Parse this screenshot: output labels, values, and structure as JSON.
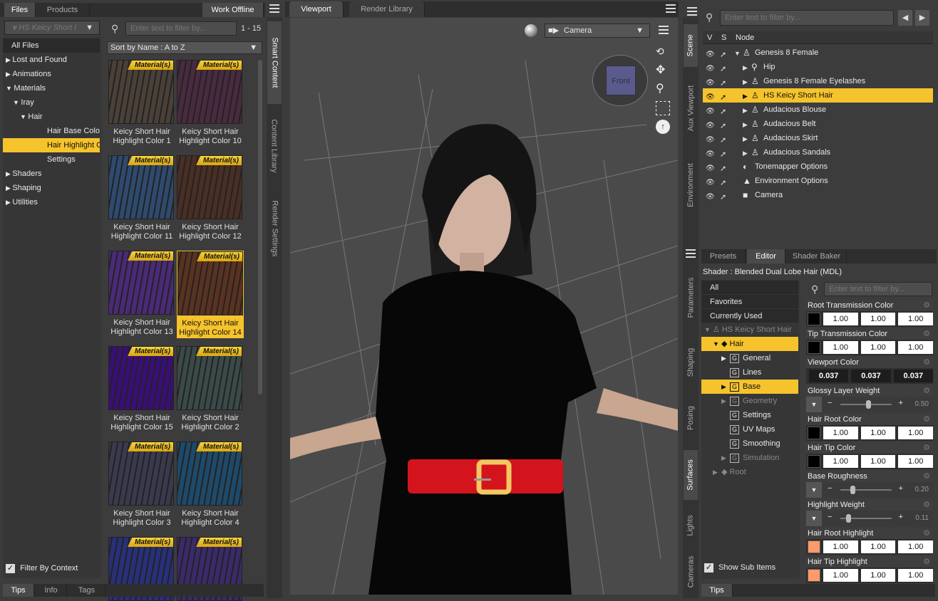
{
  "left": {
    "tabs": [
      "Files",
      "Products",
      "Work Offline"
    ],
    "filter_label": "HS Keicy Short I",
    "search_placeholder": "Enter text to filter by...",
    "count": "1 - 15",
    "sort": "Sort by Name : A to Z",
    "tree": [
      {
        "label": "All Files",
        "indent": 0,
        "arrow": "",
        "selected": false,
        "header": true
      },
      {
        "label": "Lost and Found",
        "indent": 0,
        "arrow": "right"
      },
      {
        "label": "Animations",
        "indent": 0,
        "arrow": "right"
      },
      {
        "label": "Materials",
        "indent": 0,
        "arrow": "down"
      },
      {
        "label": "Iray",
        "indent": 1,
        "arrow": "down"
      },
      {
        "label": "Hair",
        "indent": 2,
        "arrow": "down"
      },
      {
        "label": "Hair Base Colors",
        "indent": 3,
        "arrow": ""
      },
      {
        "label": "Hair Highlight C...",
        "indent": 3,
        "arrow": "",
        "selected": true
      },
      {
        "label": "Settings",
        "indent": 3,
        "arrow": ""
      },
      {
        "label": "Shaders",
        "indent": 0,
        "arrow": "right"
      },
      {
        "label": "Shaping",
        "indent": 0,
        "arrow": "right"
      },
      {
        "label": "Utilities",
        "indent": 0,
        "arrow": "right"
      }
    ],
    "filter_by_context": "Filter By Context",
    "bottom_tabs": [
      "Tips",
      "Info",
      "Tags"
    ],
    "badge": "Material(s)",
    "thumbs": [
      {
        "l1": "Keicy Short Hair",
        "l2": "Highlight Color 1",
        "color": "#4a4038"
      },
      {
        "l1": "Keicy Short Hair",
        "l2": "Highlight Color 10",
        "color": "#4a2a40"
      },
      {
        "l1": "Keicy Short Hair",
        "l2": "Highlight Color 11",
        "color": "#2e4a6e"
      },
      {
        "l1": "Keicy Short Hair",
        "l2": "Highlight Color 12",
        "color": "#4a2e24"
      },
      {
        "l1": "Keicy Short Hair",
        "l2": "Highlight Color 13",
        "color": "#4a2a78"
      },
      {
        "l1": "Keicy Short Hair",
        "l2": "Highlight Color 14",
        "color": "#5a3220",
        "selected": true
      },
      {
        "l1": "Keicy Short Hair",
        "l2": "Highlight Color 15",
        "color": "#3a0e78"
      },
      {
        "l1": "Keicy Short Hair",
        "l2": "Highlight Color 2",
        "color": "#3a4a48"
      },
      {
        "l1": "Keicy Short Hair",
        "l2": "Highlight Color 3",
        "color": "#3a3a4e"
      },
      {
        "l1": "Keicy Short Hair",
        "l2": "Highlight Color 4",
        "color": "#1e4a6a"
      },
      {
        "l1": "",
        "l2": "",
        "color": "#28307a"
      },
      {
        "l1": "",
        "l2": "",
        "color": "#3a2a6a"
      }
    ]
  },
  "sidetabs": {
    "left": [
      "Smart Content",
      "Content Library",
      "Render Settings"
    ],
    "right": [
      "Scene",
      "Aux Viewport",
      "Environment"
    ],
    "right_lower": [
      "Parameters",
      "Shaping",
      "Posing",
      "Surfaces",
      "Lights",
      "Cameras"
    ]
  },
  "viewport": {
    "tabs": [
      "Viewport",
      "Render Library"
    ],
    "camera": "Camera",
    "cube_label": "Front"
  },
  "scene": {
    "search_placeholder": "Enter text to filter by...",
    "cols": [
      "V",
      "S",
      "Node"
    ],
    "nodes": [
      {
        "label": "Genesis 8 Female",
        "indent": 0,
        "arrow": "▼",
        "icon": "figure"
      },
      {
        "label": "Hip",
        "indent": 1,
        "arrow": "▶",
        "icon": "bone"
      },
      {
        "label": "Genesis 8 Female Eyelashes",
        "indent": 1,
        "arrow": "▶",
        "icon": "figure"
      },
      {
        "label": "HS Keicy Short Hair",
        "indent": 1,
        "arrow": "▶",
        "icon": "figure",
        "selected": true
      },
      {
        "label": "Audacious Blouse",
        "indent": 1,
        "arrow": "▶",
        "icon": "figure"
      },
      {
        "label": "Audacious Belt",
        "indent": 1,
        "arrow": "▶",
        "icon": "figure"
      },
      {
        "label": "Audacious Skirt",
        "indent": 1,
        "arrow": "▶",
        "icon": "figure"
      },
      {
        "label": "Audacious Sandals",
        "indent": 1,
        "arrow": "▶",
        "icon": "figure"
      },
      {
        "label": "Tonemapper Options",
        "indent": 0,
        "arrow": "",
        "icon": "tone"
      },
      {
        "label": "Environment Options",
        "indent": 0,
        "arrow": "",
        "icon": "env"
      },
      {
        "label": "Camera",
        "indent": 0,
        "arrow": "",
        "icon": "camera"
      }
    ]
  },
  "surfaces": {
    "tabs": [
      "Presets",
      "Editor",
      "Shader Baker"
    ],
    "shader": "Shader : Blended Dual Lobe Hair (MDL)",
    "search_placeholder": "Enter text to filter by...",
    "filters": [
      "All",
      "Favorites",
      "Currently Used"
    ],
    "tree": [
      {
        "label": "HS Keicy Short Hair",
        "indent": 0,
        "arrow": "▼",
        "icon": "fig",
        "dim": true
      },
      {
        "label": "Hair",
        "indent": 1,
        "arrow": "▼",
        "icon": "mat",
        "selected": true
      },
      {
        "label": "General",
        "indent": 2,
        "arrow": "▶",
        "icon": "g"
      },
      {
        "label": "Lines",
        "indent": 2,
        "arrow": "",
        "icon": "g"
      },
      {
        "label": "Base",
        "indent": 2,
        "arrow": "▶",
        "icon": "g",
        "selected": true
      },
      {
        "label": "Geometry",
        "indent": 2,
        "arrow": "▶",
        "icon": "g",
        "dim": true
      },
      {
        "label": "Settings",
        "indent": 2,
        "arrow": "",
        "icon": "g"
      },
      {
        "label": "UV Maps",
        "indent": 2,
        "arrow": "",
        "icon": "g"
      },
      {
        "label": "Smoothing",
        "indent": 2,
        "arrow": "",
        "icon": "g"
      },
      {
        "label": "Simulation",
        "indent": 2,
        "arrow": "▶",
        "icon": "g",
        "dim": true
      },
      {
        "label": "Root",
        "indent": 1,
        "arrow": "▶",
        "icon": "mat",
        "dim": true
      }
    ],
    "show_sub_items": "Show Sub Items",
    "bottom_tab": "Tips",
    "props": [
      {
        "name": "Root Transmission Color",
        "type": "color",
        "swatch": "#000000",
        "vals": [
          "1.00",
          "1.00",
          "1.00"
        ]
      },
      {
        "name": "Tip Transmission Color",
        "type": "color",
        "swatch": "#000000",
        "vals": [
          "1.00",
          "1.00",
          "1.00"
        ]
      },
      {
        "name": "Viewport Color",
        "type": "dark",
        "vals": [
          "0.037",
          "0.037",
          "0.037"
        ]
      },
      {
        "name": "Glossy Layer Weight",
        "type": "slider",
        "value": "0.50",
        "frac": 0.5
      },
      {
        "name": "Hair Root Color",
        "type": "color",
        "swatch": "#000000",
        "vals": [
          "1.00",
          "1.00",
          "1.00"
        ]
      },
      {
        "name": "Hair Tip Color",
        "type": "color",
        "swatch": "#000000",
        "vals": [
          "1.00",
          "1.00",
          "1.00"
        ]
      },
      {
        "name": "Base Roughness",
        "type": "slider",
        "value": "0.20",
        "frac": 0.2
      },
      {
        "name": "Highlight Weight",
        "type": "slider",
        "value": "0.11",
        "frac": 0.11
      },
      {
        "name": "Hair Root Highlight",
        "type": "color",
        "swatch": "#ff9a6a",
        "vals": [
          "1.00",
          "1.00",
          "1.00"
        ]
      },
      {
        "name": "Hair Tip Highlight",
        "type": "color",
        "swatch": "#ff9a6a",
        "vals": [
          "1.00",
          "1.00",
          "1.00"
        ]
      }
    ]
  },
  "colors": {
    "accent": "#f5c32c",
    "panel": "#3c3c3c",
    "dark": "#2e2e2e"
  }
}
